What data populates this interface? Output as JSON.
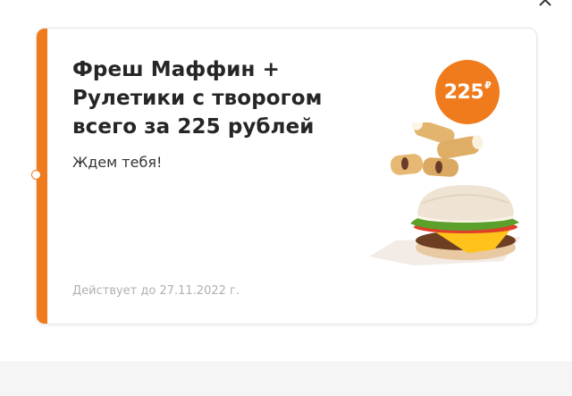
{
  "coupon": {
    "title": "Фреш Маффин + Рулетики с творогом всего за 225 рублей",
    "subtitle": "Ждем тебя!",
    "valid_until": "Действует до 27.11.2022 г.",
    "price": "225",
    "currency_symbol": "₽",
    "image_icon": "food-photo-muffin-and-rolls"
  },
  "colors": {
    "accent": "#f07b1d",
    "title_text": "#262626",
    "muted_text": "#b0b0b0",
    "card_border": "#e6e6e6",
    "bottom_band": "#f5f5f5"
  }
}
